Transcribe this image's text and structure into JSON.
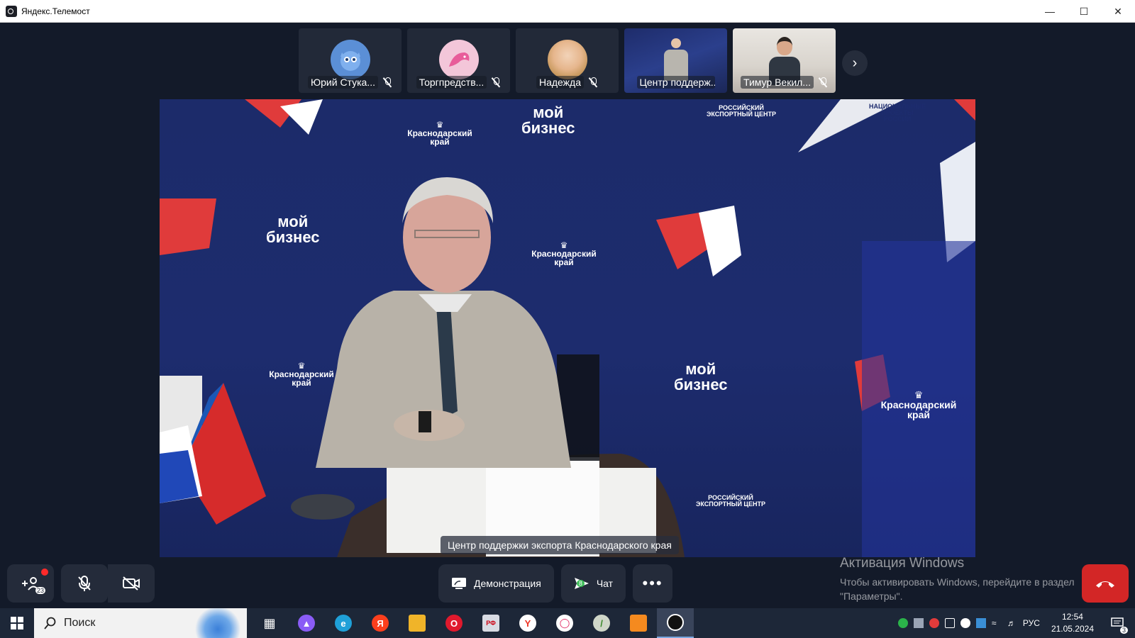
{
  "window": {
    "title": "Яндекс.Телемост"
  },
  "participants": [
    {
      "name": "Юрий Стука...",
      "type": "avatar",
      "color": "#5b8fd6"
    },
    {
      "name": "Торгпредств...",
      "type": "avatar",
      "color": "#e85c9a"
    },
    {
      "name": "Надежда",
      "type": "photo",
      "color": "#d9b48a"
    },
    {
      "name": "Центр поддерж...",
      "type": "video"
    },
    {
      "name": "Тимур Векил...",
      "type": "video"
    }
  ],
  "main_video": {
    "caption": "Центр поддержки экспорта Краснодарского края",
    "backdrop_texts": {
      "moy_biznes": "мой бизнес",
      "krasnodar": "Краснодарский край",
      "rec": "РОССИЙСКИЙ ЭКСПОРТНЫЙ ЦЕНТР",
      "natproj": "НАЦИОНАЛЬНЫЕ ПРОЕКТЫ РОССИИ"
    }
  },
  "controls": {
    "participants_count": "23",
    "demo_label": "Демонстрация",
    "chat_label": "Чат",
    "chat_count": "8"
  },
  "watermark": {
    "line1": "Активация Windows",
    "line2": "Чтобы активировать Windows, перейдите в раздел",
    "line3": "\"Параметры\"."
  },
  "taskbar": {
    "search_placeholder": "Поиск",
    "lang": "РУС",
    "time": "12:54",
    "date": "21.05.2024",
    "notif_count": "3"
  },
  "colors": {
    "accent_red": "#d32626",
    "bg": "#131a29",
    "panel": "#242b3a"
  }
}
